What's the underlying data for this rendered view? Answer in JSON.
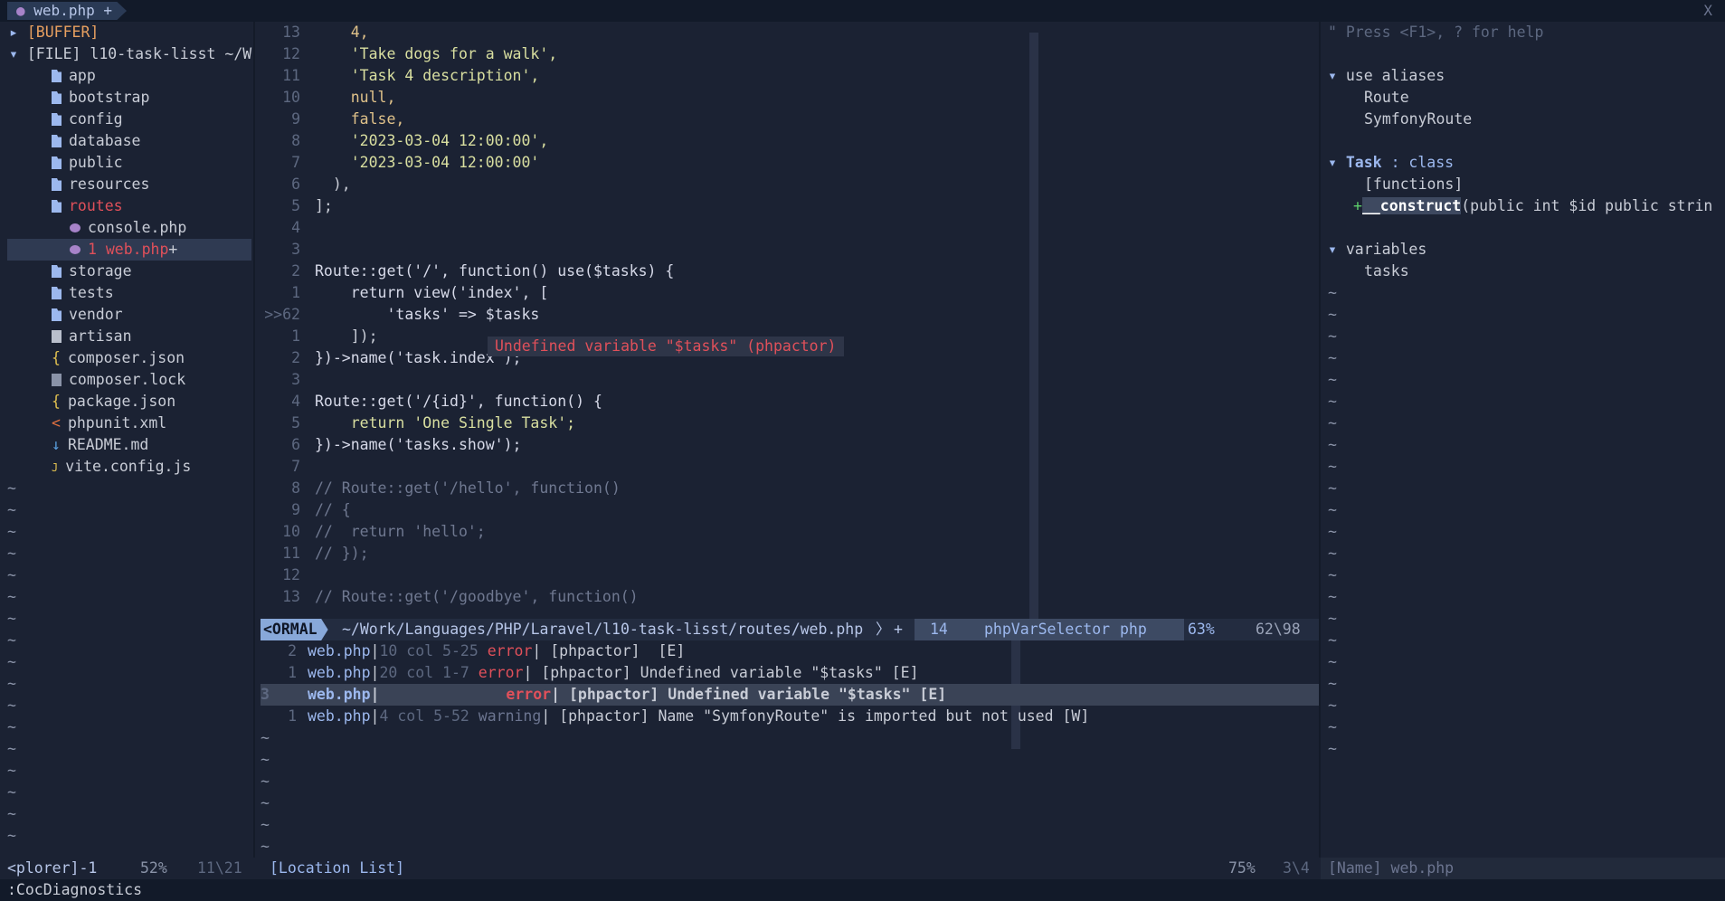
{
  "tabline": {
    "tab_label": "web.php +",
    "close": "X"
  },
  "explorer": {
    "buffer": "[BUFFER]",
    "file_root": "[FILE] l10-task-lisst ~/W",
    "items": [
      {
        "label": "app",
        "type": "folder"
      },
      {
        "label": "bootstrap",
        "type": "folder"
      },
      {
        "label": "config",
        "type": "folder"
      },
      {
        "label": "database",
        "type": "folder"
      },
      {
        "label": "public",
        "type": "folder"
      },
      {
        "label": "resources",
        "type": "folder"
      },
      {
        "label": "routes",
        "type": "folder-open"
      },
      {
        "label": "console.php",
        "type": "php"
      },
      {
        "label": "1 web.php",
        "type": "php-active",
        "suffix": "+"
      },
      {
        "label": "storage",
        "type": "folder"
      },
      {
        "label": "tests",
        "type": "folder"
      },
      {
        "label": "vendor",
        "type": "folder"
      },
      {
        "label": "artisan",
        "type": "file"
      },
      {
        "label": "composer.json",
        "type": "json"
      },
      {
        "label": "composer.lock",
        "type": "lock"
      },
      {
        "label": "package.json",
        "type": "json"
      },
      {
        "label": "phpunit.xml",
        "type": "xml"
      },
      {
        "label": "README.md",
        "type": "md"
      },
      {
        "label": "vite.config.js",
        "type": "js"
      }
    ]
  },
  "editor": {
    "lines": [
      {
        "n": "13",
        "code": "    4,"
      },
      {
        "n": "12",
        "code": "    'Take dogs for a walk',"
      },
      {
        "n": "11",
        "code": "    'Task 4 description',"
      },
      {
        "n": "10",
        "code": "    null,"
      },
      {
        "n": "9",
        "code": "    false,"
      },
      {
        "n": "8",
        "code": "    '2023-03-04 12:00:00',"
      },
      {
        "n": "7",
        "code": "    '2023-03-04 12:00:00'"
      },
      {
        "n": "6",
        "code": "  ),"
      },
      {
        "n": "5",
        "code": "];"
      },
      {
        "n": "4",
        "code": ""
      },
      {
        "n": "3",
        "code": ""
      },
      {
        "n": "2",
        "code": "Route::get('/', function() use($tasks) {"
      },
      {
        "n": "1",
        "code": "    return view('index', ["
      },
      {
        "n": ">>62",
        "code": "        'tasks' => $tasks"
      },
      {
        "n": "1",
        "code": "    ]);"
      },
      {
        "n": "2",
        "code": "})->name('task.index');"
      },
      {
        "n": "3",
        "code": ""
      },
      {
        "n": "4",
        "code": "Route::get('/{id}', function() {"
      },
      {
        "n": "5",
        "code": "    return 'One Single Task';"
      },
      {
        "n": "6",
        "code": "})->name('tasks.show');"
      },
      {
        "n": "7",
        "code": ""
      },
      {
        "n": "8",
        "code": "// Route::get('/hello', function()"
      },
      {
        "n": "9",
        "code": "// {"
      },
      {
        "n": "10",
        "code": "//  return 'hello';"
      },
      {
        "n": "11",
        "code": "// });"
      },
      {
        "n": "12",
        "code": ""
      },
      {
        "n": "13",
        "code": "// Route::get('/goodbye', function()"
      }
    ],
    "error_popup": "Undefined variable \"$tasks\" (phpactor)"
  },
  "statusline": {
    "mode": "<ORMAL",
    "path": "~/Work/Languages/PHP/Laravel/l10-task-lisst/routes/web.php",
    "modified": "+",
    "col": "14",
    "symbol": "phpVarSelector",
    "filetype": "php",
    "percent": "63%",
    "position": "62\\98"
  },
  "location_list": [
    {
      "n": "2",
      "file": "web.php",
      "loc": "10 col 5-25",
      "sev": "error",
      "msg": "[phpactor]  [E]"
    },
    {
      "n": "1",
      "file": "web.php",
      "loc": "20 col 1-7",
      "sev": "error",
      "msg": "[phpactor] Undefined variable \"$tasks\" [E]"
    },
    {
      "n": "3",
      "file": "web.php",
      "loc": "",
      "sev": "error",
      "msg": "[phpactor] Undefined variable \"$tasks\" [E]"
    },
    {
      "n": "1",
      "file": "web.php",
      "loc": "4 col 5-52",
      "sev": "warning",
      "msg": "[phpactor] Name \"SymfonyRoute\" is imported but not used [W]"
    }
  ],
  "outline": {
    "help": "\" Press <F1>, ? for help",
    "groups": [
      {
        "title": "use aliases",
        "items": [
          "Route",
          "SymfonyRoute"
        ]
      },
      {
        "title": "Task",
        "kind": ": class",
        "sub": "[functions]",
        "member": "__construct",
        "member_sig": "(public int $id public strin"
      },
      {
        "title": "variables",
        "items": [
          "tasks"
        ]
      }
    ]
  },
  "bottom": {
    "explorer_name": "<plorer]-1",
    "explorer_pct": "52%",
    "explorer_pos": "11\\21",
    "loclist_name": "[Location List]",
    "loclist_pct": "75%",
    "loclist_pos": "3\\4",
    "outline_name": "[Name] web.php"
  },
  "cmdline": ":CocDiagnostics"
}
